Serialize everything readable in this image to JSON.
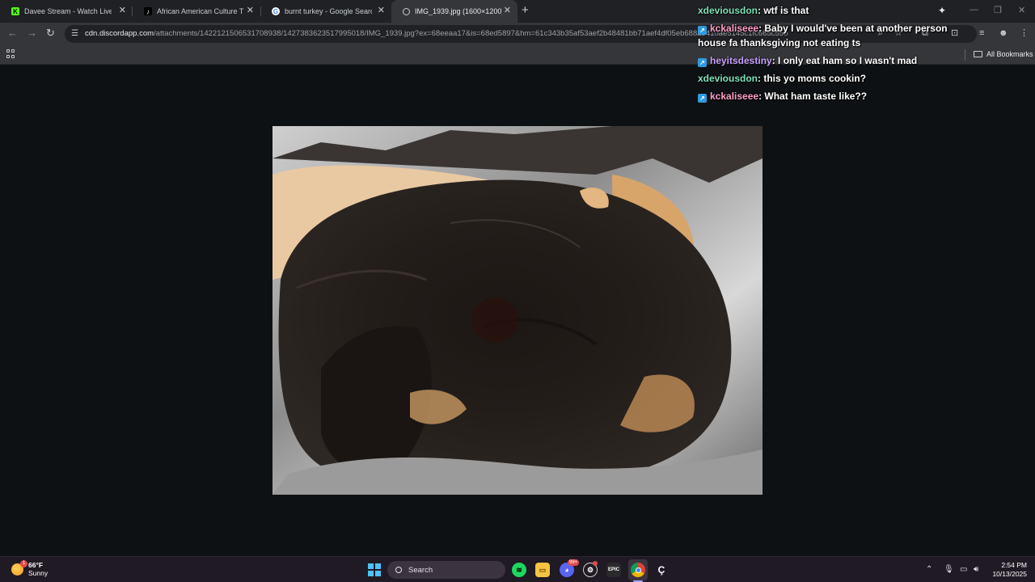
{
  "browser": {
    "tabs": [
      {
        "title": "Davee Stream - Watch Live on Kick",
        "icon": "kick-icon",
        "active": false
      },
      {
        "title": "African American Culture Through",
        "icon": "tiktok-icon",
        "active": false
      },
      {
        "title": "burnt turkey - Google Search",
        "icon": "google-icon",
        "active": false
      },
      {
        "title": "IMG_1939.jpg (1600×1200)",
        "icon": "globe-icon",
        "active": true
      }
    ],
    "url_host": "cdn.discordapp.com",
    "url_path": "/attachments/1422121506531708938/1427383623517995018/IMG_1939.jpg?ex=68eeaa17&is=68ed5897&hm=61c343b35af53aef2b48481bb71aef4df05eb688a9410ae5145c1fc665c5504a&",
    "bookmarks_label": "All Bookmarks"
  },
  "image": {
    "description_icon": "burnt-turkey-photo"
  },
  "chat": {
    "messages": [
      {
        "user": "xdeviousdon",
        "text": ": wtf is that",
        "badge": false,
        "color": "#7ee2b8"
      },
      {
        "user": "kckaliseee",
        "text": ": Baby I would've been at another person house fa thanksgiving not eating ts",
        "badge": true,
        "color": "#ff9ec8"
      },
      {
        "user": "heyitsdestiny",
        "text": ": I only eat ham so I wasn't mad",
        "badge": true,
        "color": "#c8a2ff"
      },
      {
        "user": "xdeviousdon",
        "text": ": this yo moms cookin?",
        "badge": false,
        "color": "#7ee2b8"
      },
      {
        "user": "kckaliseee",
        "text": ": What ham taste like??",
        "badge": true,
        "color": "#ff9ec8"
      }
    ]
  },
  "taskbar": {
    "weather_temp": "66°F",
    "weather_desc": "Sunny",
    "weather_badge": "1",
    "search_label": "Search",
    "discord_badge": "99+",
    "time": "2:54 PM",
    "date": "10/13/2025"
  }
}
